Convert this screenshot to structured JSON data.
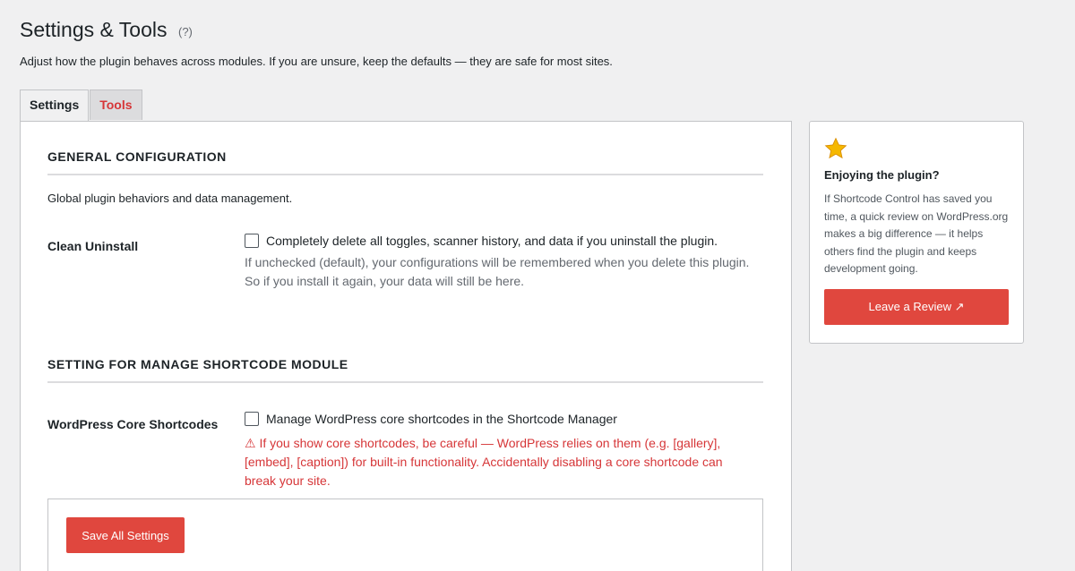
{
  "header": {
    "title": "Settings & Tools",
    "help": "(?)",
    "subtitle": "Adjust how the plugin behaves across modules. If you are unsure, keep the defaults — they are safe for most sites."
  },
  "tabs": [
    {
      "label": "Settings",
      "active": true
    },
    {
      "label": "Tools",
      "active": false
    }
  ],
  "general": {
    "heading": "GENERAL CONFIGURATION",
    "description": "Global plugin behaviors and data management.",
    "clean_uninstall": {
      "label": "Clean Uninstall",
      "checkbox_label": "Completely delete all toggles, scanner history, and data if you uninstall the plugin.",
      "checked": false,
      "help_line1": "If unchecked (default), your configurations will be remembered when you delete this plugin.",
      "help_line2": "So if you install it again, your data will still be here."
    }
  },
  "shortcode_module": {
    "heading": "SETTING FOR MANAGE SHORTCODE MODULE",
    "core_shortcodes": {
      "label": "WordPress Core Shortcodes",
      "checkbox_label": "Manage WordPress core shortcodes in the Shortcode Manager",
      "checked": false,
      "warning": "⚠ If you show core shortcodes, be careful — WordPress relies on them (e.g. [gallery], [embed], [caption]) for built-in functionality. Accidentally disabling a core shortcode can break your site."
    }
  },
  "save_button": "Save All Settings",
  "sidebar": {
    "icon": "star-icon",
    "title": "Enjoying the plugin?",
    "body": "If Shortcode Control has saved you time, a quick review on WordPress.org makes a big difference — it helps others find the plugin and keeps development going.",
    "button": "Leave a Review ↗"
  },
  "colors": {
    "accent_red": "#e0473e",
    "warning_red": "#d63638",
    "star": "#f5b800"
  }
}
